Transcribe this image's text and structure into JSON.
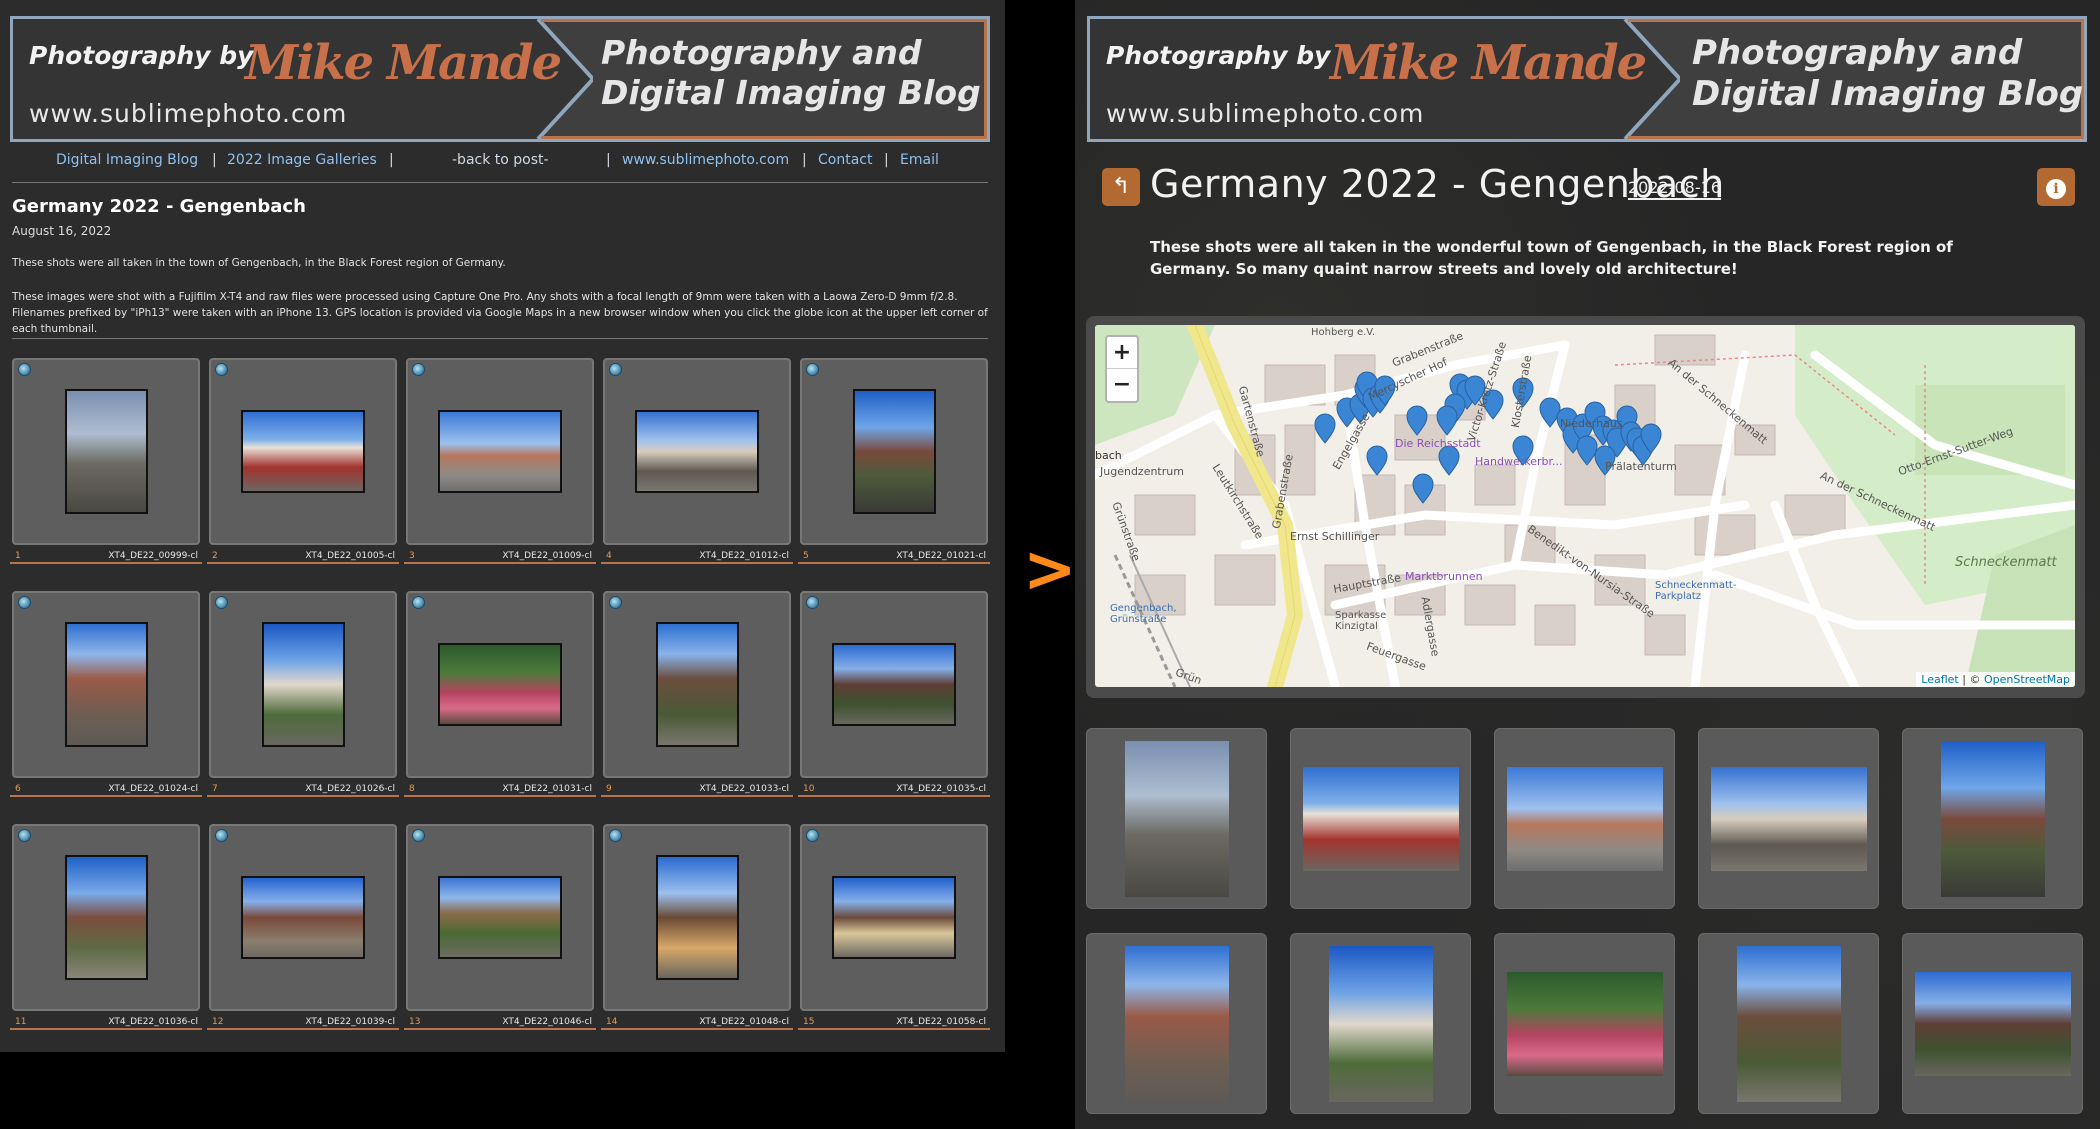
{
  "banner": {
    "by": "Photography by",
    "signature": "Mike Mande",
    "url": "www.sublimephoto.com",
    "title_line1": "Photography and",
    "title_line2": "Digital Imaging Blog"
  },
  "left": {
    "nav": {
      "blog": "Digital Imaging Blog",
      "galleries": "2022 Image Galleries",
      "back": "-back to post-",
      "site": "www.sublimephoto.com",
      "contact": "Contact",
      "email": "Email",
      "sep": "|"
    },
    "page_title": "Germany 2022 - Gengenbach",
    "date": "August 16, 2022",
    "para1": "These shots were all taken in the town of Gengenbach, in the Black Forest region of Germany.",
    "para2": "These images were shot with a Fujifilm X-T4 and raw files were processed using Capture One Pro. Any shots with a focal length of 9mm were taken with a Laowa Zero-D 9mm f/2.8. Filenames prefixed by \"iPh13\" were taken with an iPhone 13. GPS location is provided via Google Maps in a new browser window when you click the globe icon at the upper left corner of each thumbnail.",
    "thumbs": [
      {
        "num": "1",
        "file": "XT4_DE22_00999-cl"
      },
      {
        "num": "2",
        "file": "XT4_DE22_01005-cl"
      },
      {
        "num": "3",
        "file": "XT4_DE22_01009-cl"
      },
      {
        "num": "4",
        "file": "XT4_DE22_01012-cl"
      },
      {
        "num": "5",
        "file": "XT4_DE22_01021-cl"
      },
      {
        "num": "6",
        "file": "XT4_DE22_01024-cl"
      },
      {
        "num": "7",
        "file": "XT4_DE22_01026-cl"
      },
      {
        "num": "8",
        "file": "XT4_DE22_01031-cl"
      },
      {
        "num": "9",
        "file": "XT4_DE22_01033-cl"
      },
      {
        "num": "10",
        "file": "XT4_DE22_01035-cl"
      },
      {
        "num": "11",
        "file": "XT4_DE22_01036-cl"
      },
      {
        "num": "12",
        "file": "XT4_DE22_01039-cl"
      },
      {
        "num": "13",
        "file": "XT4_DE22_01046-cl"
      },
      {
        "num": "14",
        "file": "XT4_DE22_01048-cl"
      },
      {
        "num": "15",
        "file": "XT4_DE22_01058-cl"
      }
    ]
  },
  "arrow": ">",
  "right": {
    "back_icon": "back-arrow-icon",
    "info_icon": "info-icon",
    "title": "Germany 2022 - Gengenbach",
    "date": "2022-08-16",
    "description": "These shots were all taken in the wonderful town of Gengenbach, in the Black Forest region of Germany. So many quaint narrow streets and lovely old architecture!",
    "map": {
      "zoom_in": "+",
      "zoom_out": "−",
      "attribution_leaflet": "Leaflet",
      "attribution_sep": "|",
      "attribution_copy": "©",
      "attribution_osm": "OpenStreetMap",
      "labels": {
        "grabenstrasse_top": "Grabenstraße",
        "mercyscher": "Mercyscher Hof",
        "gartenstrasse": "Gartenstraße",
        "leutkirchstrasse": "Leutkirchstraße",
        "grabenstrasse_left": "Grabenstraße",
        "ernst": "Ernst Schillinger",
        "hauptstrasse": "Hauptstraße",
        "jugendzentrum": "Jugendzentrum",
        "grunstrasse": "Grünstraße",
        "gengenbach_station": "Gengenbach, Grünstraße",
        "sparkasse": "Sparkasse Kinzigtal",
        "marktbrunnen": "Marktbrunnen",
        "adlergasse": "Adlergasse",
        "feuergasse": "Feuergasse",
        "klosterstrasse": "Klosterstraße",
        "benedikt": "Benedikt-von-Nursia-Straße",
        "schneckenmatt": "An der Schneckenmatt",
        "otto": "Otto-Ernst-Sutter-Weg",
        "pralatenturm": "Prälatenturm",
        "schneckenmatt2": "Schneckenmatt",
        "schneckenmatt_parkplatz": "Schneckenmatt-Parkplatz",
        "victor": "Victor-Kretz-Straße",
        "hohberg": "Hohberg e.V.",
        "reichsstadt": "Die Reichsstadt",
        "handwerker": "Handwerkerbr...",
        "engelgasse": "Engelgasse",
        "bach": "bach",
        "grun_bottom": "Grün",
        "niederhaus": "Niederhaus"
      }
    }
  },
  "colors": {
    "accent_orange": "#b9744e",
    "banner_blue_border": "#8fa6bd",
    "link_blue": "#8fc1ee",
    "arrow_orange": "#ff8a1a",
    "marker_blue": "#3a86d4"
  }
}
